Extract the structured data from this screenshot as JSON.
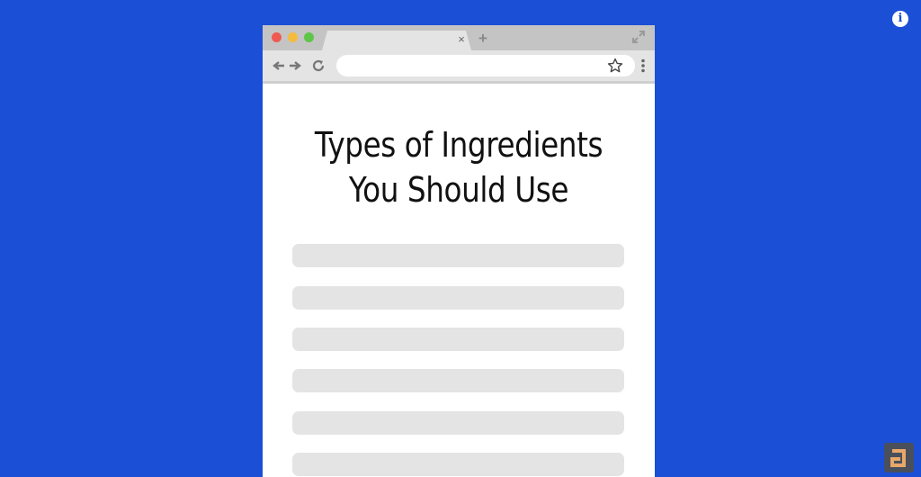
{
  "background_color": "#1a4fd6",
  "overlay": {
    "info_icon": "info-icon",
    "info_glyph": "i",
    "brand_logo": "letter-a-logo"
  },
  "browser": {
    "window_controls": {
      "close_color": "#ee5a52",
      "minimize_color": "#f4bb3e",
      "maximize_color": "#5ec548"
    },
    "tab": {
      "label": "",
      "close_glyph": "×"
    },
    "new_tab_glyph": "+",
    "address_bar": {
      "value": ""
    },
    "icons": [
      "back-arrow-icon",
      "forward-arrow-icon",
      "reload-icon",
      "bookmark-star-icon",
      "kebab-menu-icon",
      "fullscreen-expand-icon"
    ]
  },
  "page": {
    "title_line1": "Types of Ingredients",
    "title_line2": "You Should Use",
    "placeholder_line_count": 6
  }
}
